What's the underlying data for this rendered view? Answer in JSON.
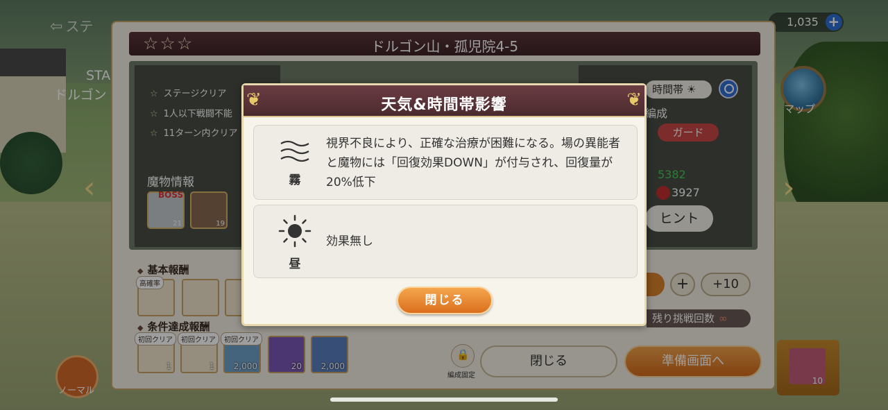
{
  "hud": {
    "back_label": "ステ",
    "resource_right": "1,035"
  },
  "map_label": "マップ",
  "normal_label": "ノーマル",
  "side_card_count": "10",
  "stage": {
    "stars": "☆☆☆",
    "title": "ドルゴン山・孤児院4-5",
    "stage_label": "STA",
    "stage_name": "ドルゴン",
    "objectives": [
      "ステージクリア",
      "1人以下戦闘不能",
      "11ターン内クリア"
    ],
    "monster_header": "魔物情報",
    "monsters": [
      {
        "level": "21",
        "tag": "BOSS"
      },
      {
        "level": "19",
        "tag": ""
      }
    ],
    "time_label": "時間帯",
    "formation_label": "編成",
    "guard_label": "ガード",
    "power_a": "5382",
    "power_b": "3927",
    "hint_label": "ヒント",
    "plus_label": "+",
    "plus10_label": "+10",
    "retry_label": "残り挑戦回数",
    "retry_value": "∞",
    "basic_reward_title": "基本報酬",
    "high_rate_tag": "高確率",
    "cond_reward_title": "条件達成報酬",
    "first_clear_tag": "初回クリア",
    "cond_items": [
      {
        "count": "1"
      },
      {
        "count": "1"
      },
      {
        "count": "2,000"
      },
      {
        "count": "20"
      },
      {
        "count": "2,000"
      }
    ],
    "lock_label": "編成固定",
    "close_label": "閉じる",
    "prepare_label": "準備画面へ"
  },
  "modal": {
    "title": "天気&時間帯影響",
    "effects": [
      {
        "icon": "fog-icon",
        "label": "霧",
        "description": "視界不良により、正確な治療が困難になる。場の異能者と魔物には「回復効果DOWN」が付与され、回復量が20%低下"
      },
      {
        "icon": "sun-icon",
        "label": "昼",
        "description": "効果無し"
      }
    ],
    "close_label": "閉じる"
  },
  "colors": {
    "header_bg": "#4a2a2e",
    "accent_orange": "#db6f1e",
    "guard_red": "#c84a46",
    "link_blue": "#2f6fd6"
  }
}
